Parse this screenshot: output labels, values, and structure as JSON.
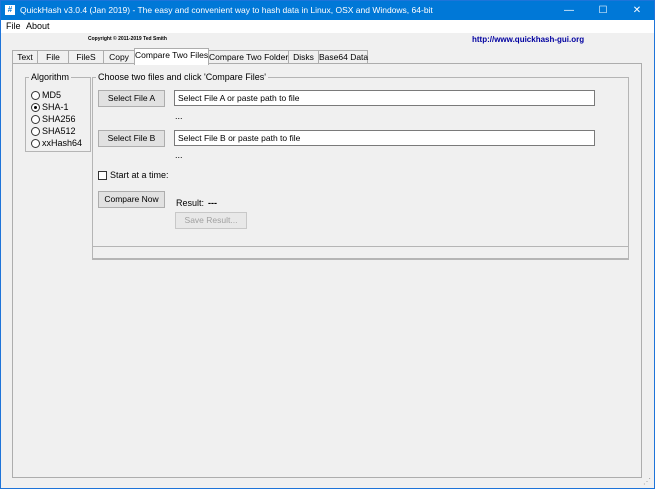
{
  "window": {
    "title": "QuickHash v3.0.4 (Jan 2019) - The easy and convenient way to hash data in Linux, OSX and Windows, 64-bit",
    "app_icon": "#",
    "controls": {
      "minimize": "—",
      "maximize": "☐",
      "close": "✕"
    }
  },
  "menu": {
    "file": "File",
    "about": "About"
  },
  "header": {
    "copyright": "Copyright © 2011-2019  Ted Smith",
    "url": "http://www.quickhash-gui.org"
  },
  "tabs": [
    "Text",
    "File",
    "FileS",
    "Copy",
    "Compare Two Files",
    "Compare Two Folders",
    "Disks",
    "Base64 Data"
  ],
  "active_tab": "Compare Two Files",
  "algorithm": {
    "title": "Algorithm",
    "options": [
      "MD5",
      "SHA-1",
      "SHA256",
      "SHA512",
      "xxHash64"
    ],
    "selected": "SHA-1"
  },
  "compare": {
    "group_title": "Choose two files and click 'Compare Files'",
    "select_a_label": "Select File A",
    "select_a_value": "Select File A or paste path to file",
    "hash_a": "...",
    "select_b_label": "Select File B",
    "select_b_value": "Select File B or paste path to file",
    "hash_b": "...",
    "start_at_label": "Start at a time:",
    "compare_now_label": "Compare Now",
    "result_label": "Result:",
    "result_value": "---",
    "save_result_label": "Save Result..."
  },
  "colors": {
    "titlebar": "#0078d7",
    "url": "#0000a0"
  }
}
